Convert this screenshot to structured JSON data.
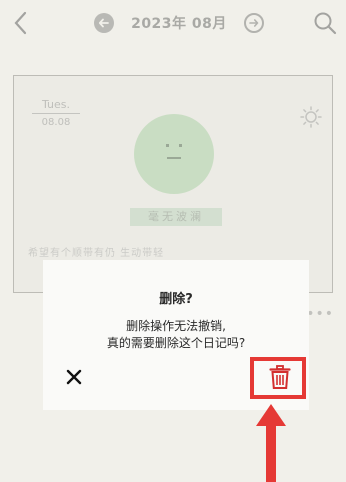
{
  "header": {
    "month_title": "2023年 08月",
    "back_icon": "chevron-left-icon",
    "prev_icon": "arrow-left-circle-icon",
    "next_icon": "arrow-right-circle-icon",
    "search_icon": "search-icon"
  },
  "entry": {
    "weekday": "Tues.",
    "date": "08.08",
    "weather_icon": "sun-icon",
    "mood_label": "毫无波澜",
    "preview_text": "希望有个顺带有仍 生动带轻",
    "more_icon": "more-dots-icon"
  },
  "dialog": {
    "title": "删除?",
    "message_line1": "删除操作无法撤销,",
    "message_line2": "真的需要删除这个日记吗?",
    "cancel_icon": "close-icon",
    "delete_icon": "trash-icon"
  },
  "annotation": {
    "highlight_color": "#e53935",
    "arrow_icon": "arrow-up-icon"
  }
}
